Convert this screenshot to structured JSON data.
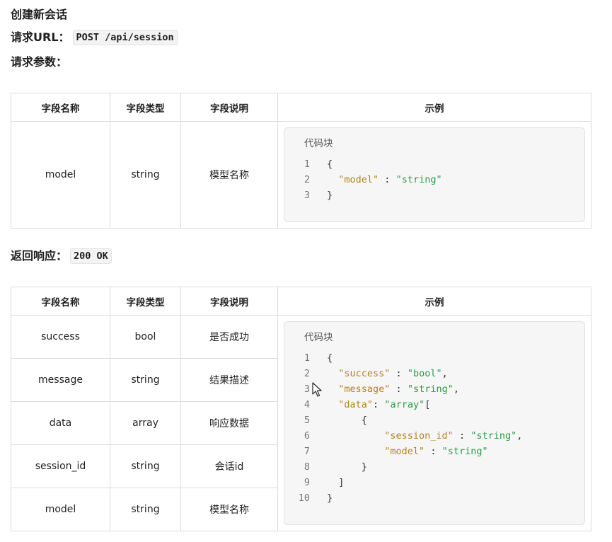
{
  "section_title": "创建新会话",
  "request_url_label": "请求URL：",
  "request_url": "POST /api/session",
  "request_params_label": "请求参数：",
  "response_label": "返回响应：",
  "response_status": "200 OK",
  "table_headers": [
    "字段名称",
    "字段类型",
    "字段说明",
    "示例"
  ],
  "code_block_title": "代码块",
  "request_rows": [
    {
      "name": "model",
      "type": "string",
      "desc": "模型名称"
    }
  ],
  "request_code": [
    {
      "n": "1",
      "text": "{"
    },
    {
      "n": "2",
      "key": "\"model\"",
      "sep": " : ",
      "val": "\"string\"",
      "indent": "  "
    },
    {
      "n": "3",
      "text": "}"
    }
  ],
  "response_rows": [
    {
      "name": "success",
      "type": "bool",
      "desc": "是否成功"
    },
    {
      "name": "message",
      "type": "string",
      "desc": "结果描述"
    },
    {
      "name": "data",
      "type": "array",
      "desc": "响应数据"
    },
    {
      "name": "session_id",
      "type": "string",
      "desc": "会话id"
    },
    {
      "name": "model",
      "type": "string",
      "desc": "模型名称"
    }
  ],
  "response_code": [
    {
      "n": "1",
      "text": "{"
    },
    {
      "n": "2",
      "indent": "  ",
      "key": "\"success\"",
      "sep": " : ",
      "val": "\"bool\"",
      "tail": ","
    },
    {
      "n": "3",
      "indent": "  ",
      "key": "\"message\"",
      "sep": " : ",
      "val": "\"string\"",
      "tail": ","
    },
    {
      "n": "4",
      "indent": "  ",
      "key": "\"data\"",
      "sep": ": ",
      "val": "\"array\"",
      "tail": "["
    },
    {
      "n": "5",
      "text": "      {"
    },
    {
      "n": "6",
      "indent": "          ",
      "key": "\"session_id\"",
      "sep": " : ",
      "val": "\"string\"",
      "tail": ","
    },
    {
      "n": "7",
      "indent": "          ",
      "key": "\"model\"",
      "sep": " : ",
      "val": "\"string\""
    },
    {
      "n": "8",
      "text": "      }"
    },
    {
      "n": "9",
      "text": "  ]"
    },
    {
      "n": "10",
      "text": "}"
    }
  ]
}
